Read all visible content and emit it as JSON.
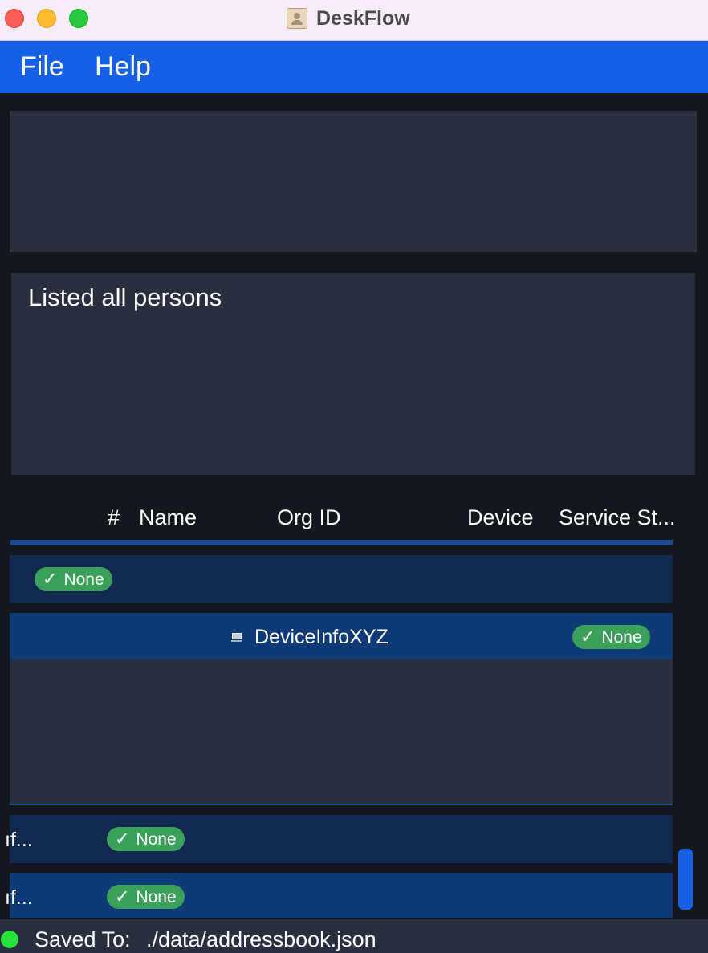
{
  "window": {
    "title": "DeskFlow"
  },
  "menu": {
    "file_label": "File",
    "help_label": "Help"
  },
  "result": {
    "message": "Listed all persons"
  },
  "table": {
    "columns": [
      "#",
      "Name",
      "Org ID",
      "Device",
      "Service St..."
    ],
    "rows": [
      {
        "status": "None"
      },
      {
        "device": "DeviceInfoXYZ",
        "status": "None"
      },
      {
        "name_fragment": "ıf...",
        "status": "None"
      },
      {
        "name_fragment": "ıf...",
        "status": "None"
      }
    ]
  },
  "status_bar": {
    "label": "Saved To:",
    "path": "./data/addressbook.json"
  },
  "colors": {
    "accent": "#1560e4",
    "status_pill": "#3aa05a",
    "save_indicator": "#28e03a"
  },
  "icons": {
    "app": "contacts-book-icon",
    "device": "laptop-icon",
    "check": "checkmark-icon"
  }
}
